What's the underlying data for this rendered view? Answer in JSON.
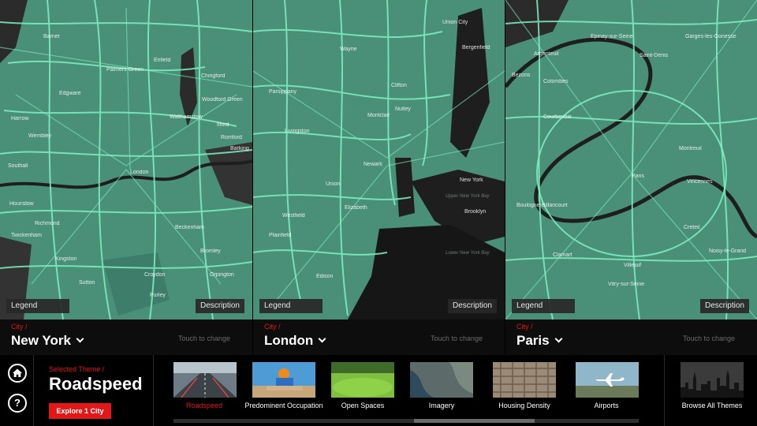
{
  "colors": {
    "accent": "#e01818",
    "road": "#7ff0c2",
    "land": "#4a8f78",
    "dark": "#262626"
  },
  "panels": [
    {
      "legend_label": "Legend",
      "description_label": "Description",
      "city_kicker": "City /",
      "city_name": "New York",
      "touch_text": "Touch to change",
      "places": [
        "Barnet",
        "Enfield",
        "Palmers Green",
        "Edgware",
        "Chingford",
        "Woodford Green",
        "Harrow",
        "Walthamstow",
        "Wembley",
        "Ilford",
        "Romford",
        "Barking",
        "Southall",
        "London",
        "Hounslow",
        "Beckenham",
        "Bromley",
        "Croydon",
        "Sutton",
        "Kingston",
        "Twickenham",
        "Richmond",
        "Orpington",
        "Purley"
      ]
    },
    {
      "legend_label": "Legend",
      "description_label": "Description",
      "city_kicker": "City /",
      "city_name": "London",
      "touch_text": "Touch to change",
      "places": [
        "Wayne",
        "Union City",
        "Bergenfield",
        "Parsippany",
        "Clifton",
        "Montclair",
        "Nutley",
        "Livingston",
        "Newark",
        "Union",
        "Elizabeth",
        "Westfield",
        "New York",
        "Brooklyn",
        "Plainfield",
        "Edison",
        "Lower New York Bay",
        "Upper New York Bay"
      ]
    },
    {
      "legend_label": "Legend",
      "description_label": "Description",
      "city_kicker": "City /",
      "city_name": "Paris",
      "touch_text": "Touch to change",
      "places": [
        "Argenteuil",
        "Epinay-sur-Seine",
        "Saint-Denis",
        "Garges-les-Gonesse",
        "Colombes",
        "Bezons",
        "Courbevoie",
        "Paris",
        "Boulogne-Billancourt",
        "Montreuil",
        "Vincennes",
        "Clamart",
        "Creteil",
        "Villejuif",
        "Vitry-sur-Seine",
        "Noisy-le-Grand"
      ]
    }
  ],
  "sidebar": {
    "home_icon": "home-icon",
    "help_label": "?"
  },
  "theme": {
    "kicker": "Selected Theme /",
    "name": "Roadspeed",
    "explore_label": "Explore 1 City"
  },
  "themes": [
    {
      "label": "Roadspeed",
      "active": true
    },
    {
      "label": "Predominent Occupation",
      "active": false
    },
    {
      "label": "Open Spaces",
      "active": false
    },
    {
      "label": "Imagery",
      "active": false
    },
    {
      "label": "Housing Density",
      "active": false
    },
    {
      "label": "Airports",
      "active": false
    }
  ],
  "browse": {
    "label": "Browse All Themes"
  }
}
